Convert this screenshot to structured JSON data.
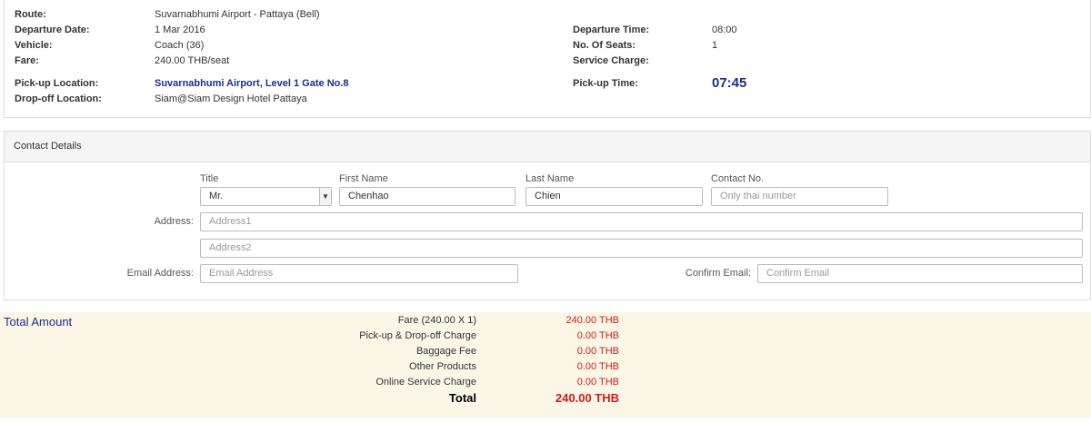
{
  "trip": {
    "route_label": "Route:",
    "route_value": "Suvarnabhumi Airport - Pattaya (Bell)",
    "departure_date_label": "Departure Date:",
    "departure_date_value": "1 Mar 2016",
    "vehicle_label": "Vehicle:",
    "vehicle_value": "Coach (36)",
    "fare_label": "Fare:",
    "fare_value": "240.00 THB/seat",
    "pickup_location_label": "Pick-up Location:",
    "pickup_location_value": "Suvarnabhumi Airport, Level 1 Gate No.8",
    "dropoff_location_label": "Drop-off Location:",
    "dropoff_location_value": "Siam@Siam Design Hotel Pattaya",
    "departure_time_label": "Departure Time:",
    "departure_time_value": "08:00",
    "seats_label": "No. Of Seats:",
    "seats_value": "1",
    "service_charge_label": "Service Charge:",
    "pickup_time_label": "Pick-up Time:",
    "pickup_time_value": "07:45"
  },
  "contact": {
    "heading": "Contact Details",
    "title_label": "Title",
    "title_value": "Mr.",
    "first_name_label": "First Name",
    "first_name_value": "Chenhao",
    "last_name_label": "Last Name",
    "last_name_value": "Chien",
    "contact_no_label": "Contact No.",
    "contact_no_placeholder": "Only thai number",
    "address_label": "Address:",
    "address1_placeholder": "Address1",
    "address2_placeholder": "Address2",
    "email_label": "Email Address:",
    "email_placeholder": "Email Address",
    "confirm_email_label": "Confirm Email:",
    "confirm_email_placeholder": "Confirm Email"
  },
  "totals": {
    "title": "Total Amount",
    "lines": [
      {
        "label": "Fare (240.00 X 1)",
        "value": "240.00 THB"
      },
      {
        "label": "Pick-up & Drop-off Charge",
        "value": "0.00 THB"
      },
      {
        "label": "Baggage Fee",
        "value": "0.00 THB"
      },
      {
        "label": "Other Products",
        "value": "0.00 THB"
      },
      {
        "label": "Online Service Charge",
        "value": "0.00 THB"
      }
    ],
    "total_label": "Total",
    "total_value": "240.00 THB"
  },
  "colors": {
    "accent_blue": "#1a2f8a",
    "price_red": "#d21c1c",
    "summary_background": "#fcf6e6"
  }
}
